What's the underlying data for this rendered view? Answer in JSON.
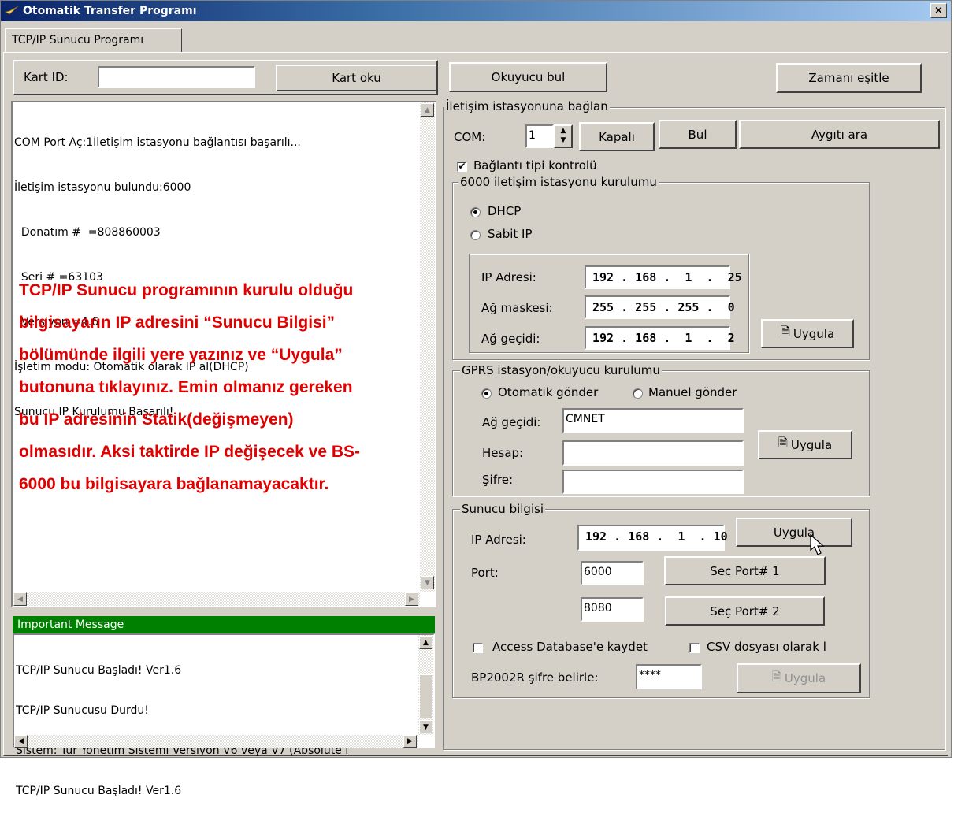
{
  "window": {
    "title": "Otomatik Transfer Programı",
    "close_label": "×"
  },
  "tab": {
    "label": "TCP/IP Sunucu Programı"
  },
  "toolbar": {
    "card_id_label": "Kart ID:",
    "card_id_value": "",
    "read_card": "Kart oku",
    "find_reader": "Okuyucu bul",
    "sync_time": "Zamanı eşitle"
  },
  "log": {
    "lines": [
      "COM Port Aç:1İletişim istasyonu bağlantısı başarılı...",
      "İletişim istasyonu bulundu:6000",
      "  Donatım #  =808860003",
      "  Seri # =63103",
      "  Versiyon =4.6",
      "İşletim modu: Otomatik olarak IP al(DHCP)",
      "Sunucu IP Kurulumu Başarılı!"
    ]
  },
  "overlay": {
    "lines": [
      "TCP/IP Sunucu programının kurulu olduğu",
      "bilgisayarın IP adresini “Sunucu Bilgisi”",
      "bölümünde ilgili yere yazınız ve “Uygula”",
      "butonuna tıklayınız. Emin olmanız gereken",
      "bu IP adresinin Statik(değişmeyen)",
      "olmasıdır. Aksi taktirde IP değişecek ve BS-",
      "6000 bu bilgisayara bağlanamayacaktır."
    ],
    "color": "#e00000"
  },
  "important": {
    "header": "Important Message",
    "header_color": "#008000",
    "lines": [
      "TCP/IP Sunucu Başladı! Ver1.6",
      "TCP/IP Sunucusu Durdu!",
      "Sistem: Tur Yönetim Sistemi Versiyon V6 veya V7 (Absolute I",
      "TCP/IP Sunucu Başladı! Ver1.6"
    ]
  },
  "connect": {
    "legend": "İletişim istasyonuna bağlan",
    "com_label": "COM:",
    "com_value": "1",
    "closed_button": "Kapalı",
    "find_button": "Bul",
    "search_device_button": "Aygıtı ara",
    "connection_check_label": "Bağlantı tipi kontrolü",
    "connection_check_checked": "✔"
  },
  "station": {
    "legend": "6000 iletişim istasyonu kurulumu",
    "dhcp_label": "DHCP",
    "static_label": "Sabit IP",
    "ip_label": "IP Adresi:",
    "ip_value": "192 . 168 .  1  .  25",
    "mask_label": "Ağ maskesi:",
    "mask_value": "255 . 255 . 255 .  0",
    "gateway_label": "Ağ geçidi:",
    "gateway_value": "192 . 168 .  1  .  2",
    "apply": "Uygula"
  },
  "gprs": {
    "legend": "GPRS istasyon/okuyucu kurulumu",
    "auto_send": "Otomatik gönder",
    "manual_send": "Manuel gönder",
    "gateway_label": "Ağ geçidi:",
    "gateway_value": "CMNET",
    "account_label": "Hesap:",
    "account_value": "",
    "password_label": "Şifre:",
    "password_value": "",
    "apply": "Uygula"
  },
  "server": {
    "legend": "Sunucu bilgisi",
    "ip_label": "IP Adresi:",
    "ip_value": "192 . 168 .  1  . 10",
    "apply": "Uygula",
    "port_label": "Port:",
    "port1_value": "6000",
    "port2_value": "8080",
    "select_port1": "Seç Port# 1",
    "select_port2": "Seç Port# 2",
    "access_label": "Access Database'e kaydet",
    "csv_label": "CSV dosyası olarak l",
    "bp_label": "BP2002R şifre belirle:",
    "bp_value": "****",
    "bp_apply": "Uygula"
  }
}
